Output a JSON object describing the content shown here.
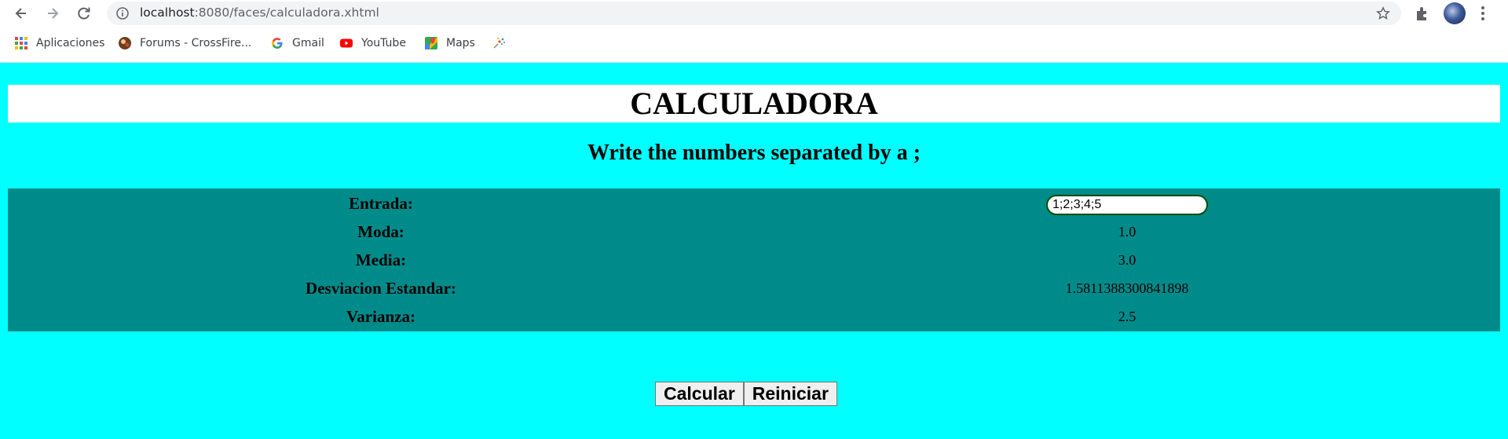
{
  "browser": {
    "url_host": "localhost",
    "url_rest": ":8080/faces/calculadora.xhtml",
    "bookmarks": [
      {
        "label": "Aplicaciones",
        "icon": "apps-grid-icon"
      },
      {
        "label": "Forums - CrossFire...",
        "icon": "crossfire-icon"
      },
      {
        "label": "Gmail",
        "icon": "google-icon"
      },
      {
        "label": "YouTube",
        "icon": "youtube-icon"
      },
      {
        "label": "Maps",
        "icon": "maps-icon"
      },
      {
        "label": "",
        "icon": "sparkle-icon"
      }
    ]
  },
  "page": {
    "title": "CALCULADORA",
    "subtitle": "Write the numbers separated by a ;",
    "rows": [
      {
        "label": "Entrada:",
        "value": "1;2;3;4;5"
      },
      {
        "label": "Moda:",
        "value": "1.0"
      },
      {
        "label": "Media:",
        "value": "3.0"
      },
      {
        "label": "Desviacion Estandar:",
        "value": "1.5811388300841898"
      },
      {
        "label": "Varianza:",
        "value": "2.5"
      }
    ],
    "buttons": {
      "calcular": "Calcular",
      "reiniciar": "Reiniciar"
    }
  },
  "colors": {
    "page_background": "#00ffff",
    "table_background": "#008b8b",
    "title_background": "#ffffff"
  }
}
